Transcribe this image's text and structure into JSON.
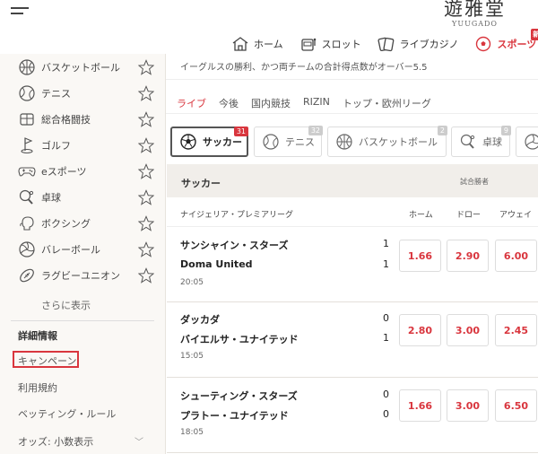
{
  "header": {
    "logo_kanji": "遊雅堂",
    "logo_roman": "YUUGADO",
    "nav": [
      {
        "label": "ホーム",
        "icon": "home-icon"
      },
      {
        "label": "スロット",
        "icon": "slot-machine-icon"
      },
      {
        "label": "ライブカジノ",
        "icon": "cards-icon"
      },
      {
        "label": "スポーツ",
        "icon": "soccer-ball-icon",
        "badge": "新",
        "active": true
      }
    ]
  },
  "sidebar": {
    "sports": [
      {
        "label": "バスケットボール",
        "icon": "basketball-icon"
      },
      {
        "label": "テニス",
        "icon": "tennis-ball-icon"
      },
      {
        "label": "総合格闘技",
        "icon": "martial-arts-icon"
      },
      {
        "label": "ゴルフ",
        "icon": "golf-icon"
      },
      {
        "label": "eスポーツ",
        "icon": "gamepad-icon"
      },
      {
        "label": "卓球",
        "icon": "table-tennis-icon"
      },
      {
        "label": "ボクシング",
        "icon": "boxing-glove-icon"
      },
      {
        "label": "バレーボール",
        "icon": "volleyball-icon"
      },
      {
        "label": "ラグビーユニオン",
        "icon": "rugby-ball-icon"
      }
    ],
    "more": "さらに表示",
    "info_heading": "詳細情報",
    "links": [
      "キャンペーン",
      "利用規約",
      "ベッティング・ルール"
    ],
    "odds_format": "オッズ: 小数表示"
  },
  "main": {
    "promo_text": "イーグルスの勝利、かつ両チームの合計得点数がオーバー5.5",
    "subtabs": [
      "ライブ",
      "今後",
      "国内競技",
      "RIZIN",
      "トップ・欧州リーグ"
    ],
    "chips": [
      {
        "label": "サッカー",
        "count": "31",
        "icon": "soccer-ball-icon",
        "active": true
      },
      {
        "label": "テニス",
        "count": "32",
        "icon": "tennis-ball-icon"
      },
      {
        "label": "バスケットボール",
        "count": "2",
        "icon": "basketball-icon"
      },
      {
        "label": "卓球",
        "count": "9",
        "icon": "table-tennis-icon"
      },
      {
        "label": "",
        "count": "",
        "icon": "volleyball-icon"
      }
    ],
    "table": {
      "title": "サッカー",
      "market": "試合勝者",
      "league": "ナイジェリア・プレミアリーグ",
      "columns": [
        "ホーム",
        "ドロー",
        "アウェイ"
      ],
      "matches": [
        {
          "home": "サンシャイン・スターズ",
          "away": "Doma United",
          "home_score": "1",
          "away_score": "1",
          "time": "20:05",
          "odds": [
            "1.66",
            "2.90",
            "6.00"
          ]
        },
        {
          "home": "ダッカダ",
          "away": "バイエルサ・ユナイテッド",
          "home_score": "0",
          "away_score": "1",
          "time": "15:05",
          "odds": [
            "2.80",
            "3.00",
            "2.45"
          ]
        },
        {
          "home": "シューティング・スターズ",
          "away": "プラトー・ユナイテッド",
          "home_score": "0",
          "away_score": "0",
          "time": "18:05",
          "odds": [
            "1.66",
            "3.00",
            "6.50"
          ]
        }
      ]
    }
  }
}
